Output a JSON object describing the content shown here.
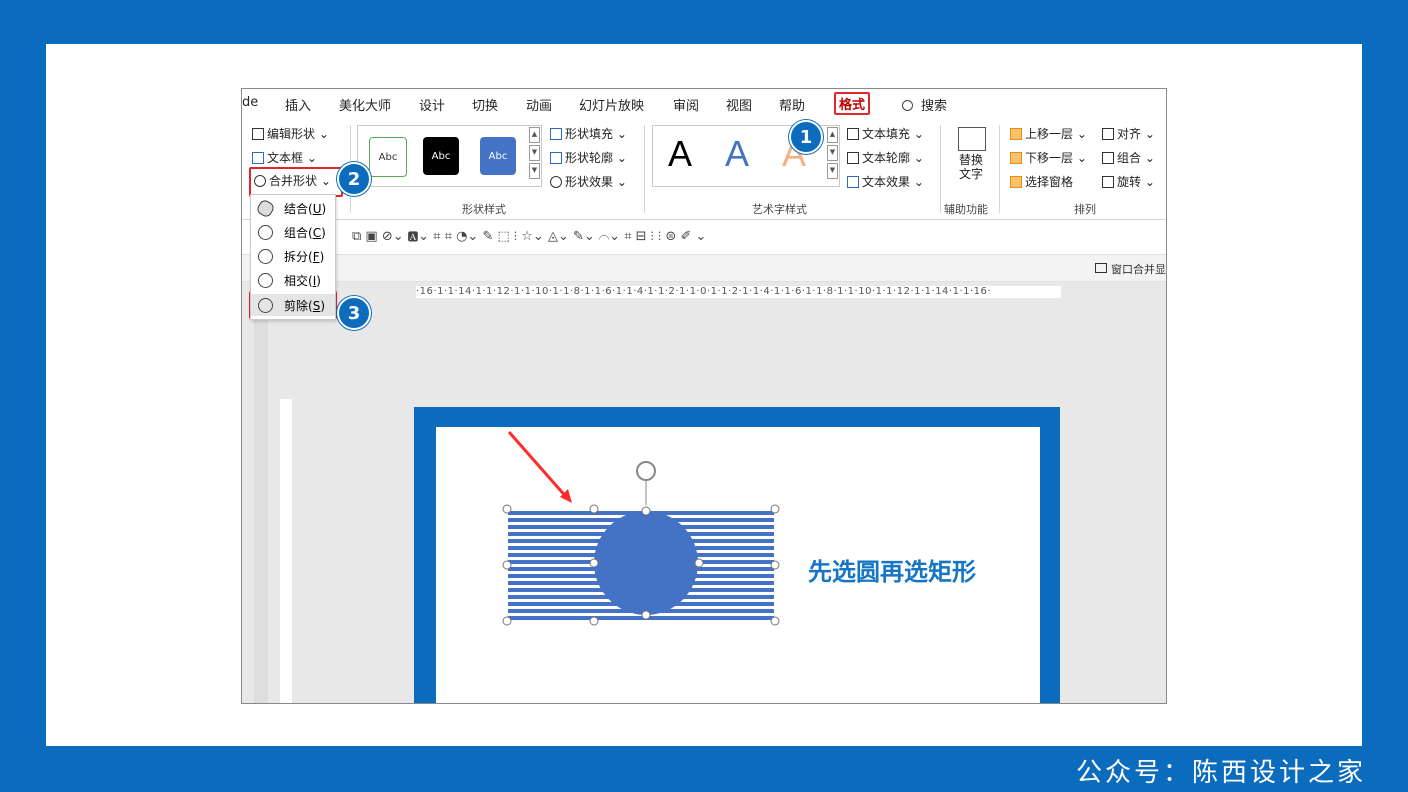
{
  "tabs": [
    "de",
    "插入",
    "美化大师",
    "设计",
    "切换",
    "动画",
    "幻灯片放映",
    "审阅",
    "视图",
    "帮助",
    "格式",
    "搜索"
  ],
  "ribbon": {
    "insert_shapes": {
      "edit_shape": "编辑形状",
      "textbox": "文本框",
      "merge_shapes": "合并形状"
    },
    "shape_styles": {
      "swatch_label": "Abc",
      "fill": "形状填充",
      "outline": "形状轮廓",
      "effects": "形状效果",
      "group_label": "形状样式"
    },
    "wordart": {
      "letter": "A",
      "text_fill": "文本填充",
      "text_outline": "文本轮廓",
      "text_effects": "文本效果",
      "group_label": "艺术字样式"
    },
    "accessibility": {
      "alt_text_line1": "替换",
      "alt_text_line2": "文字",
      "group_label": "辅助功能"
    },
    "arrange": {
      "bring_forward": "上移一层",
      "send_backward": "下移一层",
      "selection_pane": "选择窗格",
      "align": "对齐",
      "group": "组合",
      "rotate": "旋转",
      "group_label": "排列"
    }
  },
  "merge_menu": {
    "items": [
      {
        "label": "结合",
        "key": "U"
      },
      {
        "label": "组合",
        "key": "C"
      },
      {
        "label": "拆分",
        "key": "F"
      },
      {
        "label": "相交",
        "key": "I"
      },
      {
        "label": "剪除",
        "key": "S"
      }
    ]
  },
  "badges": [
    "1",
    "2",
    "3"
  ],
  "window_label": "窗口合并显",
  "ruler_text": "·16·1·1·14·1·1·12·1·1·10·1·1·8·1·1·6·1·1·4·1·1·2·1·1·0·1·1·2·1·1·4·1·1·6·1·1·8·1·1·10·1·1·12·1·1·14·1·1·16·",
  "slide_caption": "先选圆再选矩形",
  "footer": "公众号：陈西设计之家",
  "colors": {
    "accent": "#0b6bbd",
    "highlight": "#e3262c",
    "shape_blue": "#4472c4",
    "caption": "#1776c4"
  }
}
